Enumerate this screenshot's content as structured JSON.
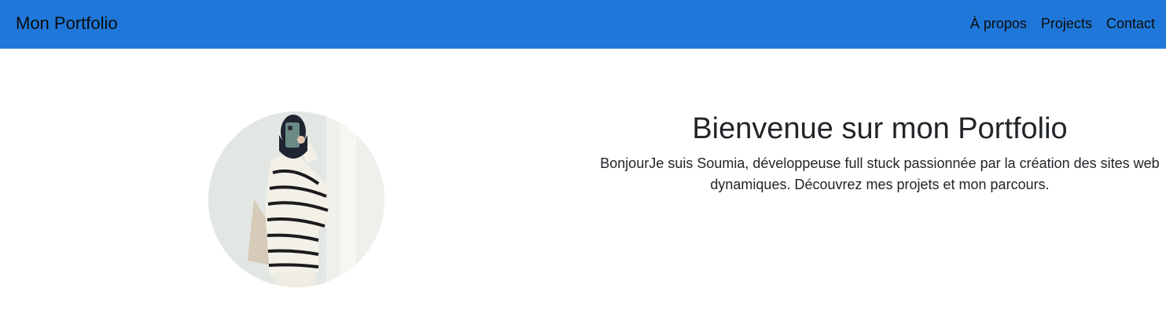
{
  "nav": {
    "brand": "Mon Portfolio",
    "links": [
      {
        "label": "À propos"
      },
      {
        "label": "Projects"
      },
      {
        "label": "Contact"
      }
    ]
  },
  "hero": {
    "title": "Bienvenue sur mon Portfolio",
    "description": "BonjourJe suis Soumia, développeuse full stuck passionnée par la création des sites web dynamiques. Découvrez mes projets et mon parcours."
  },
  "colors": {
    "navbar_background": "#1f78d9",
    "nav_text": "#0b0b0b",
    "body_text": "#212529"
  }
}
